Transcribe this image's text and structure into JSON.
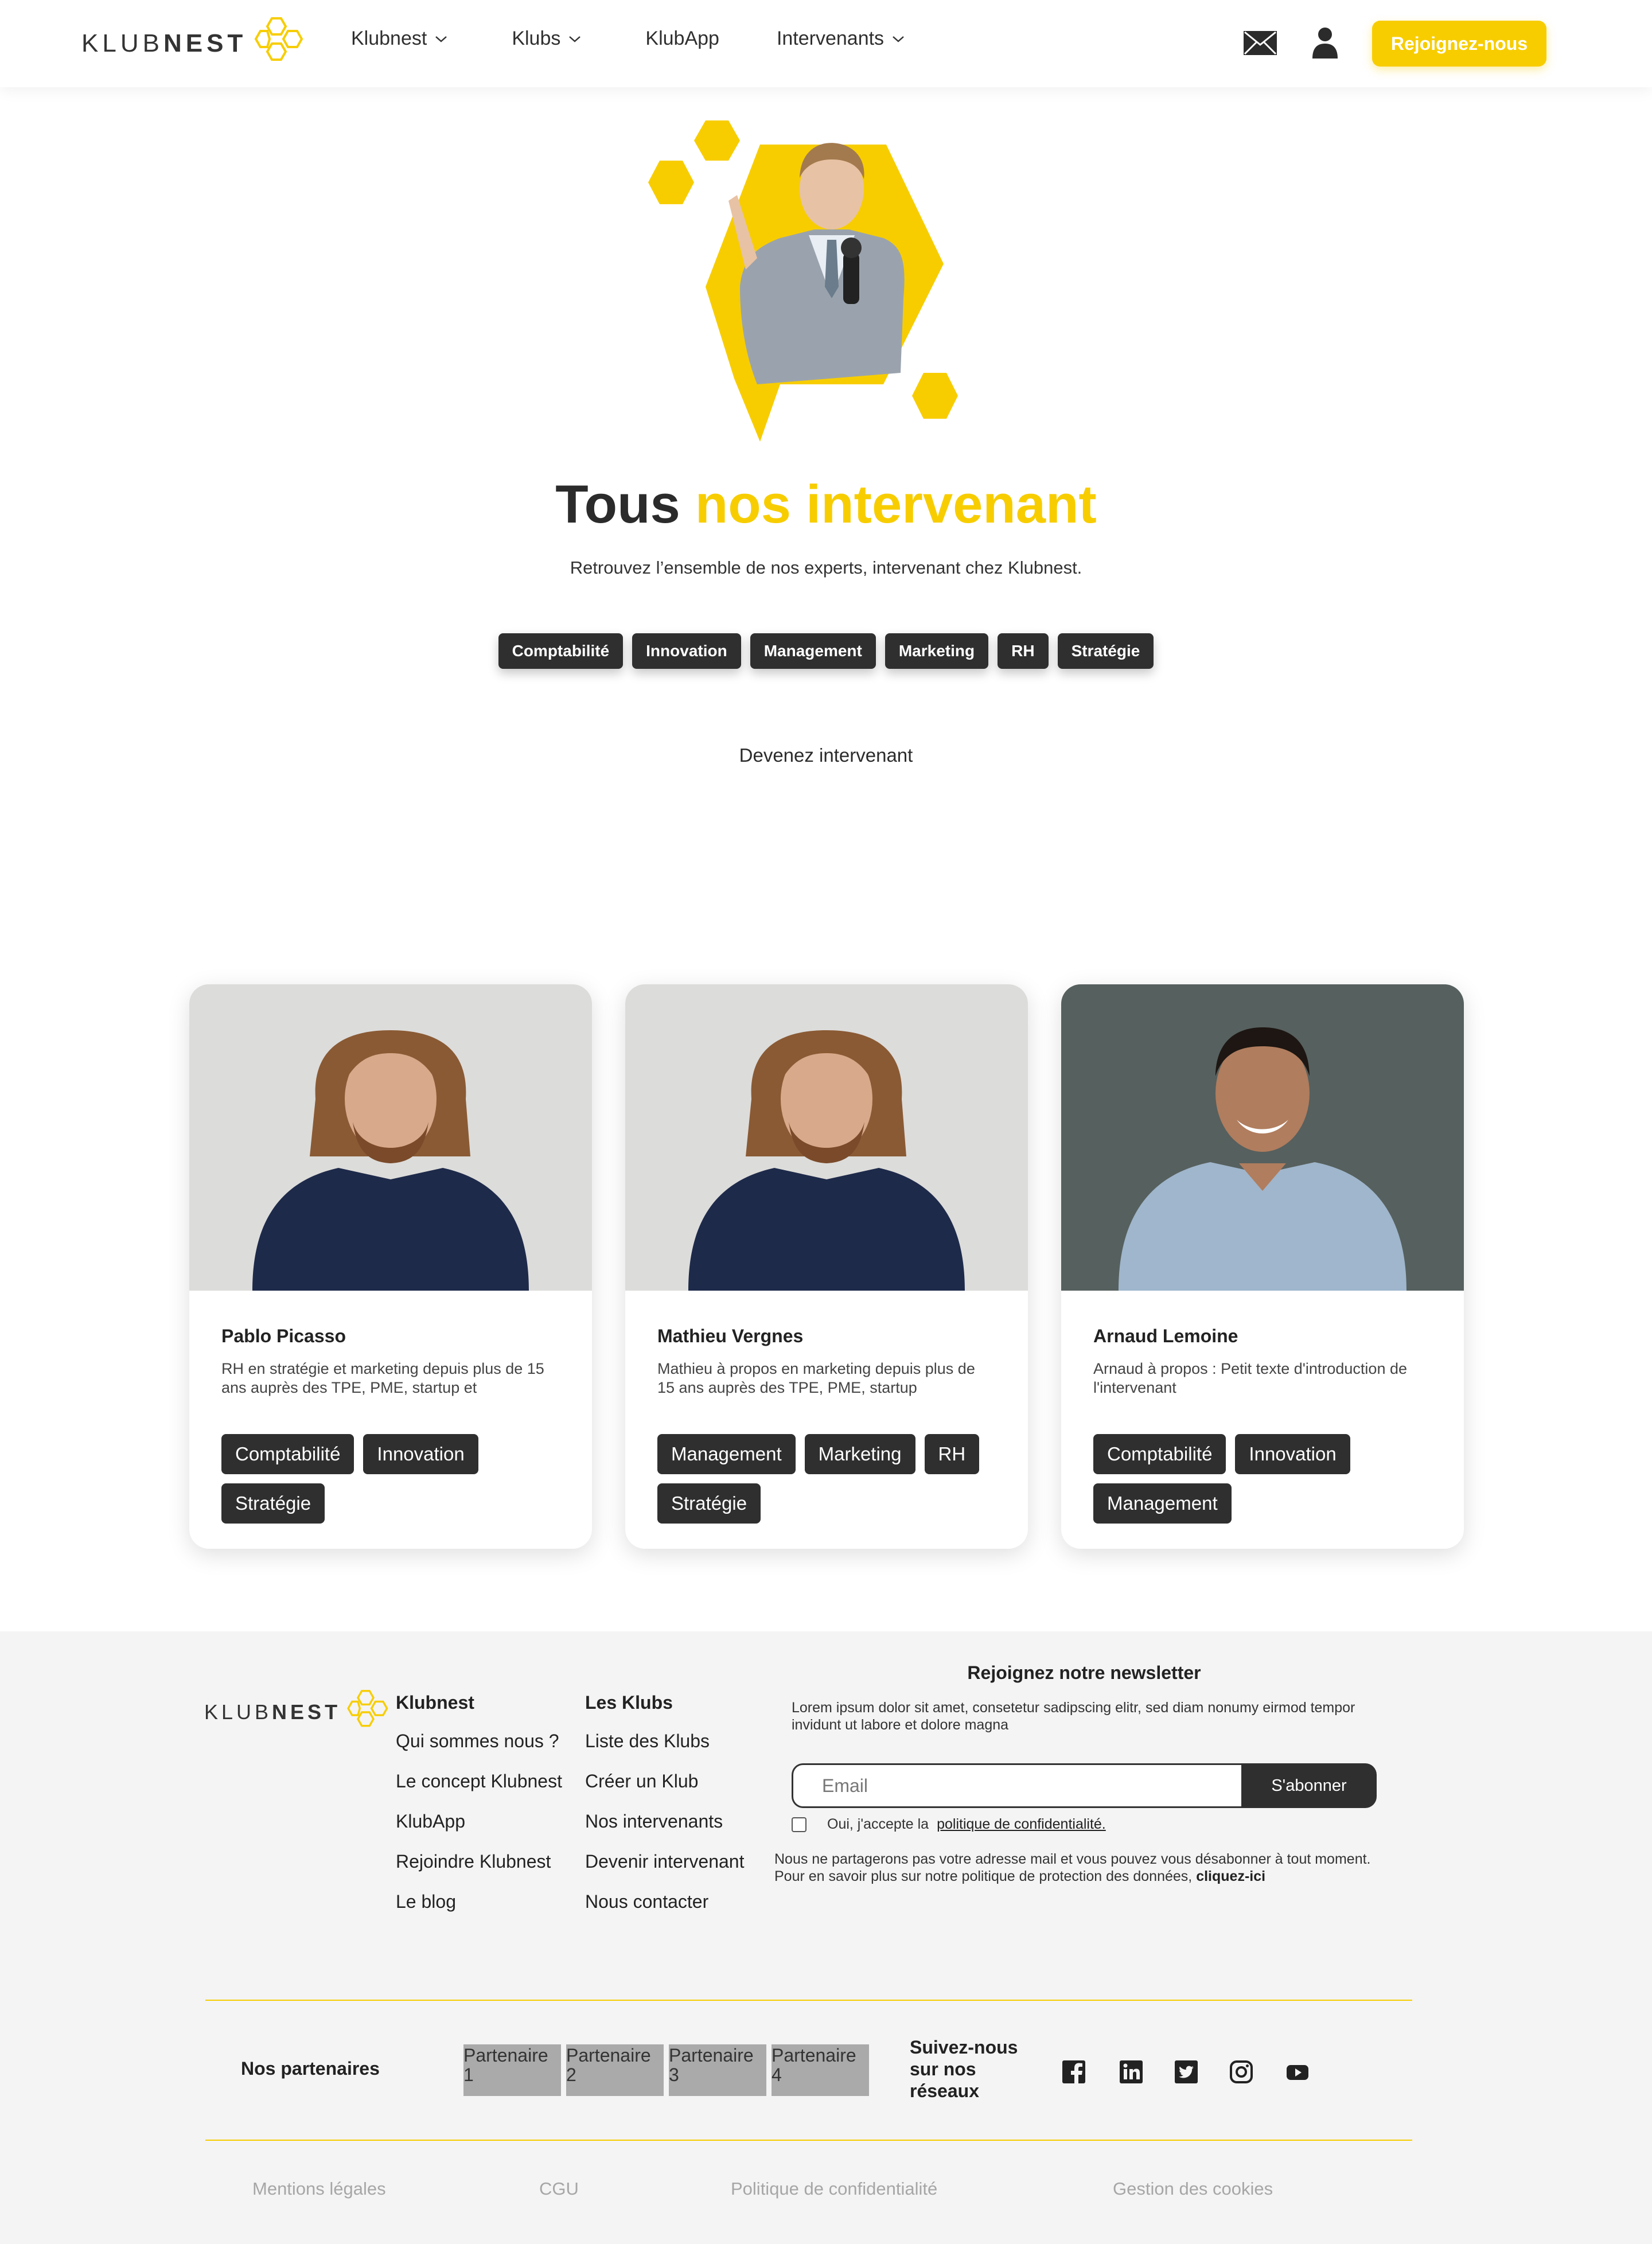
{
  "header": {
    "logo": {
      "light": "KLUB",
      "bold": "NEST"
    },
    "nav": [
      {
        "label": "Klubnest",
        "dropdown": true
      },
      {
        "label": "Klubs",
        "dropdown": true
      },
      {
        "label": "KlubApp",
        "dropdown": false
      },
      {
        "label": "Intervenants",
        "dropdown": true
      }
    ],
    "icons": [
      "mail-icon",
      "user-icon"
    ],
    "cta_label": "Rejoignez-nous"
  },
  "hero": {
    "title_plain": "Tous",
    "title_accent": "nos intervenant",
    "subtitle": "Retrouvez l’ensemble de nos experts, intervenant chez Klubnest.",
    "filters": [
      "Comptabilité",
      "Innovation",
      "Management",
      "Marketing",
      "RH",
      "Stratégie"
    ],
    "become_link": "Devenez intervenant"
  },
  "cards": [
    {
      "name": "Pablo Picasso",
      "description": "RH en stratégie et marketing depuis plus de 15 ans auprès des TPE, PME, startup et",
      "tags": [
        "Comptabilité",
        "Innovation",
        "Stratégie"
      ]
    },
    {
      "name": "Mathieu Vergnes",
      "description": "Mathieu à propos en marketing depuis plus de 15 ans auprès des TPE, PME, startup",
      "tags": [
        "Management",
        "Marketing",
        "RH",
        "Stratégie"
      ]
    },
    {
      "name": "Arnaud Lemoine",
      "description": "Arnaud à propos : Petit texte d'introduction de l'intervenant",
      "tags": [
        "Comptabilité",
        "Innovation",
        "Management"
      ]
    }
  ],
  "footer": {
    "logo": {
      "light": "KLUB",
      "bold": "NEST"
    },
    "col1": {
      "title": "Klubnest",
      "links": [
        "Qui sommes nous ?",
        "Le concept Klubnest",
        "KlubApp",
        "Rejoindre Klubnest",
        "Le blog"
      ]
    },
    "col2": {
      "title": "Les Klubs",
      "links": [
        "Liste des Klubs",
        "Créer un Klub",
        "Nos intervenants",
        "Devenir intervenant",
        "Nous contacter"
      ]
    },
    "newsletter": {
      "title": "Rejoignez notre newsletter",
      "text": "Lorem ipsum dolor sit amet, consetetur sadipscing elitr, sed diam nonumy eirmod tempor invidunt ut labore et dolore magna",
      "placeholder": "Email",
      "button": "S'abonner",
      "consent_text": "Oui, j'accepte la",
      "consent_link": "politique de confidentialité.",
      "disclaimer": "Nous ne partagerons pas votre adresse mail et vous pouvez vous désabonner à tout moment. Pour en savoir plus sur notre politique de protection des données,",
      "disclaimer_link": "cliquez-ici"
    },
    "partners_label": "Nos partenaires",
    "partners": [
      "Partenaire 1",
      "Partenaire 2",
      "Partenaire 3",
      "Partenaire 4"
    ],
    "social_label": "Suivez-nous sur nos réseaux",
    "social": [
      "facebook-icon",
      "linkedin-icon",
      "twitter-icon",
      "instagram-icon",
      "youtube-icon"
    ],
    "legal": [
      "Mentions légales",
      "CGU",
      "Politique de confidentialité",
      "Gestion des cookies"
    ]
  },
  "colors": {
    "accent": "#f7cd00",
    "dark": "#2f2f2f",
    "footer_bg": "#f4f4f4"
  }
}
